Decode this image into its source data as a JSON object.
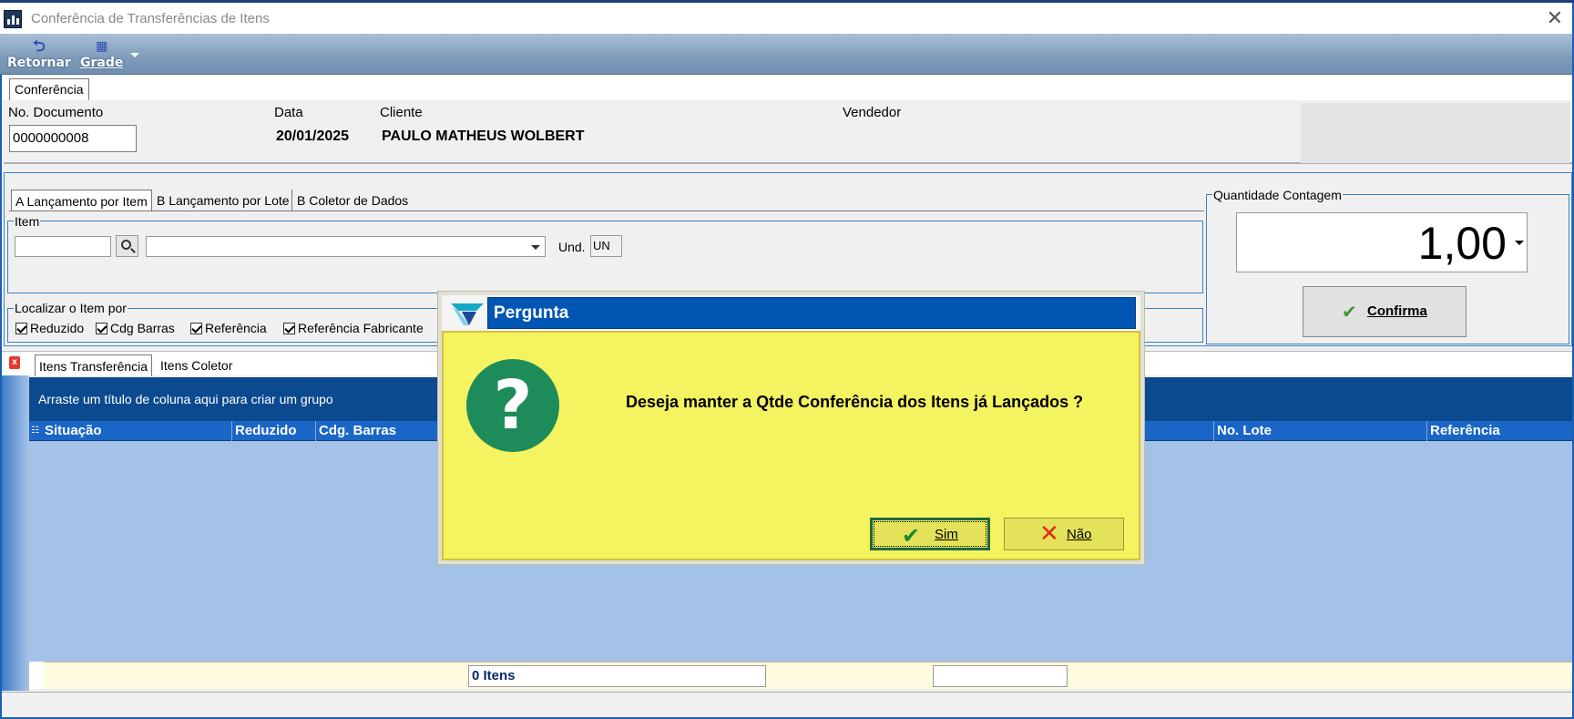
{
  "window": {
    "title": "Conferência de Transferências de Itens",
    "close_glyph": "✕"
  },
  "toolbar": {
    "back_label": "Retornar",
    "grid_label": "Grade"
  },
  "main_tab": {
    "label": "Conferência"
  },
  "header": {
    "document_label": "No. Documento",
    "document_value": "0000000008",
    "date_label": "Data",
    "date_value": "20/01/2025",
    "client_label": "Cliente",
    "client_value": "PAULO MATHEUS WOLBERT",
    "seller_label": "Vendedor"
  },
  "launch_tabs": [
    {
      "label": "A Lançamento por Item",
      "active": true
    },
    {
      "label": "B Lançamento por Lote",
      "active": false
    },
    {
      "label": "B Coletor de Dados",
      "active": false
    }
  ],
  "item_group": {
    "title": "Item",
    "unit_label": "Und.",
    "unit_value": "UN"
  },
  "locate_group": {
    "title": "Localizar o Item por",
    "options": [
      {
        "label": "Reduzido",
        "checked": true
      },
      {
        "label": "Cdg Barras",
        "checked": true
      },
      {
        "label": "Referência",
        "checked": true
      },
      {
        "label": "Referência Fabricante",
        "checked": true
      }
    ]
  },
  "quantity": {
    "title": "Quantidade Contagem",
    "value": "1,00",
    "confirm_label": "Confirma"
  },
  "grid": {
    "close_glyph": "x",
    "tabs": [
      {
        "label": "Itens Transferência",
        "active": true
      },
      {
        "label": "Itens Coletor",
        "active": false
      }
    ],
    "group_by_hint": "Arraste um título de coluna aqui para criar um grupo",
    "columns": [
      "Situação",
      "Reduzido",
      "Cdg. Barras",
      "No. Lote",
      "Referência"
    ],
    "footer_count": "0 Itens"
  },
  "dialog": {
    "title": "Pergunta",
    "icon": "question-icon",
    "icon_glyph": "?",
    "message": "Deseja manter a Qtde Conferência dos Itens já Lançados ?",
    "yes_label": "Sim",
    "no_label": "Não"
  },
  "colors": {
    "dialog_bg": "#f4f360",
    "dialog_title_bg": "#0056b3",
    "grid_header": "#1a66c7",
    "grid_body": "#a4c2e8",
    "question_circle": "#1e8c5a"
  }
}
